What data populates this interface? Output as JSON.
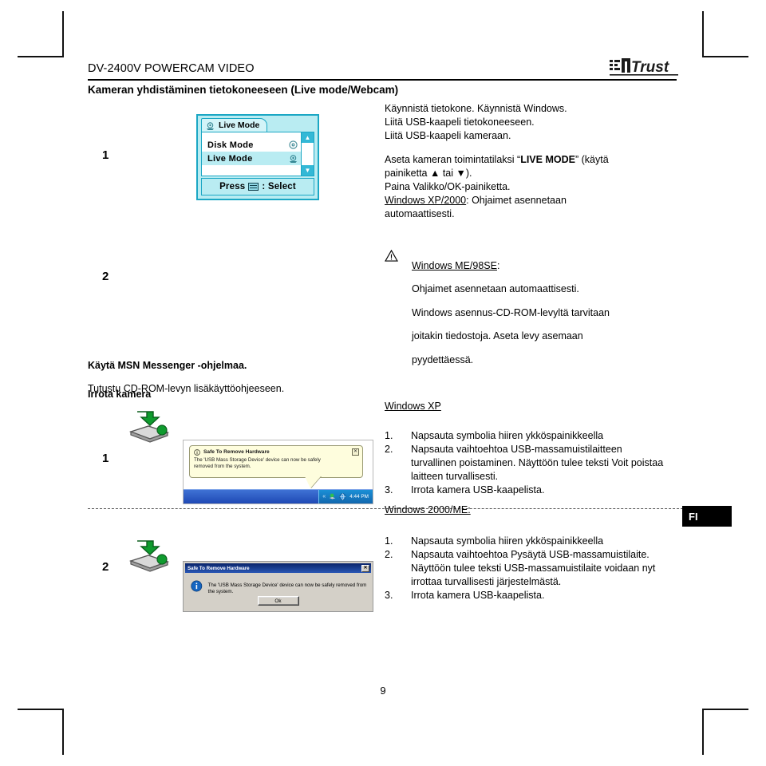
{
  "document": {
    "header_title": "DV-2400V POWERCAM VIDEO",
    "section_title": "Kameran yhdistäminen tietokoneeseen (Live mode/Webcam)",
    "logo_text": "Trust",
    "page_number": "9",
    "language_badge": "FI"
  },
  "steps": {
    "step1_number": "1",
    "step2_number": "2"
  },
  "lcd": {
    "tab_label": "Live Mode",
    "tab_icon": "live-mode-icon",
    "rows": [
      {
        "label": "Disk Mode",
        "icon": "disk-mode-icon",
        "selected": false
      },
      {
        "label": "Live Mode",
        "icon": "live-mode-icon",
        "selected": true
      }
    ],
    "scroll_up": "▲",
    "scroll_down": "▼",
    "footer_prefix": "Press",
    "footer_suffix": ": Select",
    "footer_glyph": "menu-button-icon"
  },
  "instructions_top": {
    "line1": "Käynnistä tietokone. Käynnistä Windows.",
    "line2": "Liitä USB-kaapeli tietokoneeseen.",
    "line3": "Liitä USB-kaapeli kameraan.",
    "line4_pre": "Aseta kameran toimintatilaksi “",
    "line4_bold": "LIVE MODE",
    "line4_post": "” (käytä",
    "line5": "painiketta ▲ tai ▼).",
    "line6": "Paina Valikko/OK-painiketta.",
    "line7_u": "Windows XP/2000",
    "line7_rest": ": Ohjaimet asennetaan",
    "line8": "automaattisesti."
  },
  "warning": {
    "icon": "warning-triangle-icon",
    "title_u": "Windows ME/98SE",
    "title_colon": ":",
    "line1": "Ohjaimet asennetaan automaattisesti.",
    "line2": "Windows asennus-CD-ROM-levyltä tarvitaan",
    "line3": "joitakin tiedostoja. Aseta levy asemaan",
    "line4": "pyydettäessä."
  },
  "middle": {
    "heading": "Käytä MSN Messenger -ohjelmaa.",
    "subtext": "Tutustu CD-ROM-levyn lisäkäyttöohjeeseen.",
    "irrota_heading": "Irrota kamera"
  },
  "rows": {
    "row1_number": "1",
    "row2_number": "2",
    "tray_icon": "safely-remove-hardware-tray-icon"
  },
  "screenshot_xp": {
    "balloon_title": "Safe To Remove Hardware",
    "balloon_icon": "info-icon",
    "balloon_close": "✕",
    "balloon_body_line1": "The 'USB Mass Storage Device' device can now be safely",
    "balloon_body_line2": "removed from the system.",
    "tray_chevron": "«",
    "tray_clock": "4:44 PM",
    "tray_icon_1": "safely-remove-hardware-tray-icon",
    "tray_icon_2": "network-globe-icon"
  },
  "screenshot_2k": {
    "title": "Safe To Remove Hardware",
    "close_label": "✕",
    "icon": "info-icon",
    "message": "The 'USB Mass Storage Device' device can now be safely removed from the system.",
    "ok_label": "Ok"
  },
  "windows_xp_block": {
    "label": "Windows XP",
    "items": [
      {
        "n": "1.",
        "text": "Napsauta symbolia hiiren ykköspainikkeella"
      },
      {
        "n": "2.",
        "text": "Napsauta vaihtoehtoa USB-massamuistilaitteen turvallinen poistaminen. Näyttöön tulee teksti Voit poistaa laitteen turvallisesti."
      },
      {
        "n": "3.",
        "text": "Irrota kamera USB-kaapelista."
      }
    ]
  },
  "windows_2k_block": {
    "label": "Windows 2000/ME:",
    "items": [
      {
        "n": "1.",
        "text": "Napsauta symbolia hiiren ykköspainikkeella"
      },
      {
        "n": "2.",
        "text": "Napsauta vaihtoehtoa Pysäytä USB-massamuistilaite. Näyttöön tulee teksti USB-massamuistilaite voidaan nyt irrottaa turvallisesti järjestelmästä."
      },
      {
        "n": "3.",
        "text": "Irrota kamera USB-kaapelista."
      }
    ]
  }
}
